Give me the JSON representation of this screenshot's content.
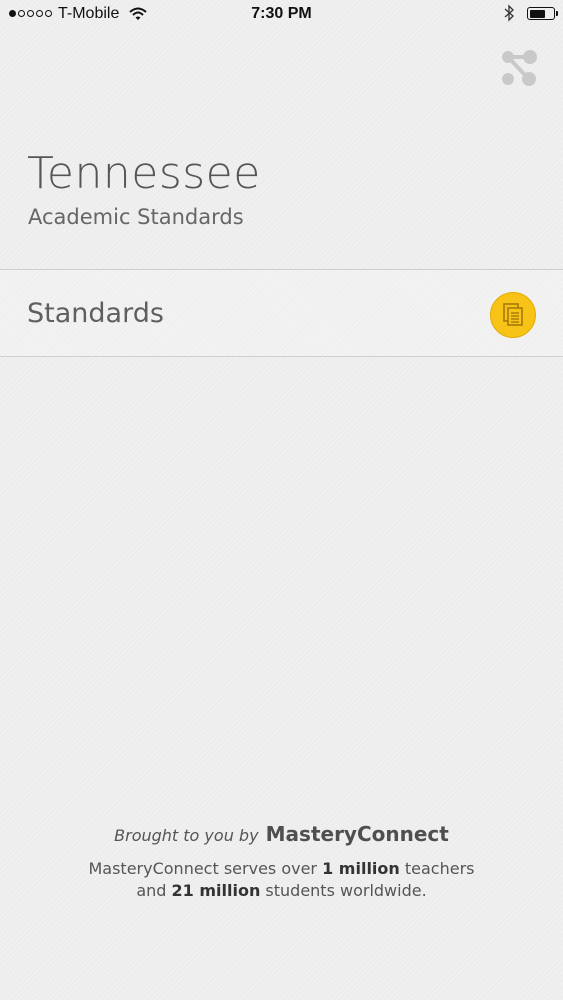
{
  "status_bar": {
    "carrier": "T-Mobile",
    "time": "7:30 PM",
    "signal_filled": 1,
    "signal_total": 5,
    "battery_level": 0.7
  },
  "icons": {
    "share": "share-icon",
    "standards": "copy-documents-icon",
    "wifi": "wifi-icon",
    "bluetooth": "bluetooth-icon",
    "battery": "battery-icon"
  },
  "header": {
    "title": "Tennessee",
    "subtitle": "Academic Standards"
  },
  "list": {
    "items": [
      {
        "label": "Standards"
      }
    ]
  },
  "footer": {
    "brought_prefix": "Brought to you by",
    "brand": "MasteryConnect",
    "serves_line1_start": "MasteryConnect serves over ",
    "serves_line1_bold": "1 million",
    "serves_line1_end": " teachers",
    "serves_line2_start": "and ",
    "serves_line2_bold": "21 million",
    "serves_line2_end": " students worldwide."
  },
  "colors": {
    "background": "#efeeee",
    "accent_yellow": "#f6c316",
    "divider": "#cfcfcf",
    "text": "#5a5a5a"
  }
}
